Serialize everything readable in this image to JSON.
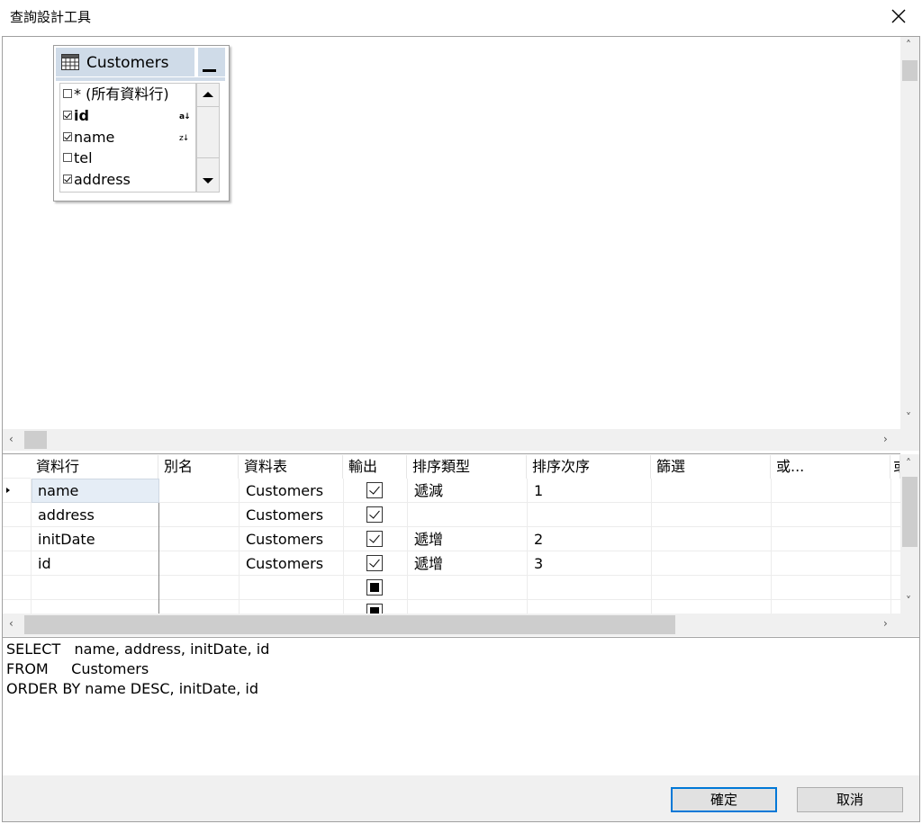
{
  "window": {
    "title": "查詢設計工具"
  },
  "diagram": {
    "table": {
      "name": "Customers",
      "columns": [
        {
          "label": "* (所有資料行)",
          "checked": false,
          "sort": ""
        },
        {
          "label": "id",
          "checked": true,
          "sort": "↓",
          "bold": true
        },
        {
          "label": "name",
          "checked": true,
          "sort": "↓"
        },
        {
          "label": "tel",
          "checked": false,
          "sort": ""
        },
        {
          "label": "address",
          "checked": true,
          "sort": ""
        }
      ]
    }
  },
  "grid": {
    "headers": [
      "資料行",
      "別名",
      "資料表",
      "輸出",
      "排序類型",
      "排序次序",
      "篩選",
      "或...",
      "或"
    ],
    "rows": [
      {
        "column": "name",
        "alias": "",
        "table": "Customers",
        "output": true,
        "sort_type": "遞減",
        "sort_order": "1"
      },
      {
        "column": "address",
        "alias": "",
        "table": "Customers",
        "output": true,
        "sort_type": "",
        "sort_order": ""
      },
      {
        "column": "initDate",
        "alias": "",
        "table": "Customers",
        "output": true,
        "sort_type": "遞增",
        "sort_order": "2"
      },
      {
        "column": "id",
        "alias": "",
        "table": "Customers",
        "output": true,
        "sort_type": "遞增",
        "sort_order": "3"
      }
    ]
  },
  "sql": {
    "lines": [
      "SELECT   name, address, initDate, id",
      "FROM     Customers",
      "ORDER BY name DESC, initDate, id"
    ]
  },
  "buttons": {
    "ok": "確定",
    "cancel": "取消"
  },
  "colors": {
    "accent": "#0078d7",
    "selection": "#e5edf6",
    "table_header": "#cfdbe8"
  }
}
